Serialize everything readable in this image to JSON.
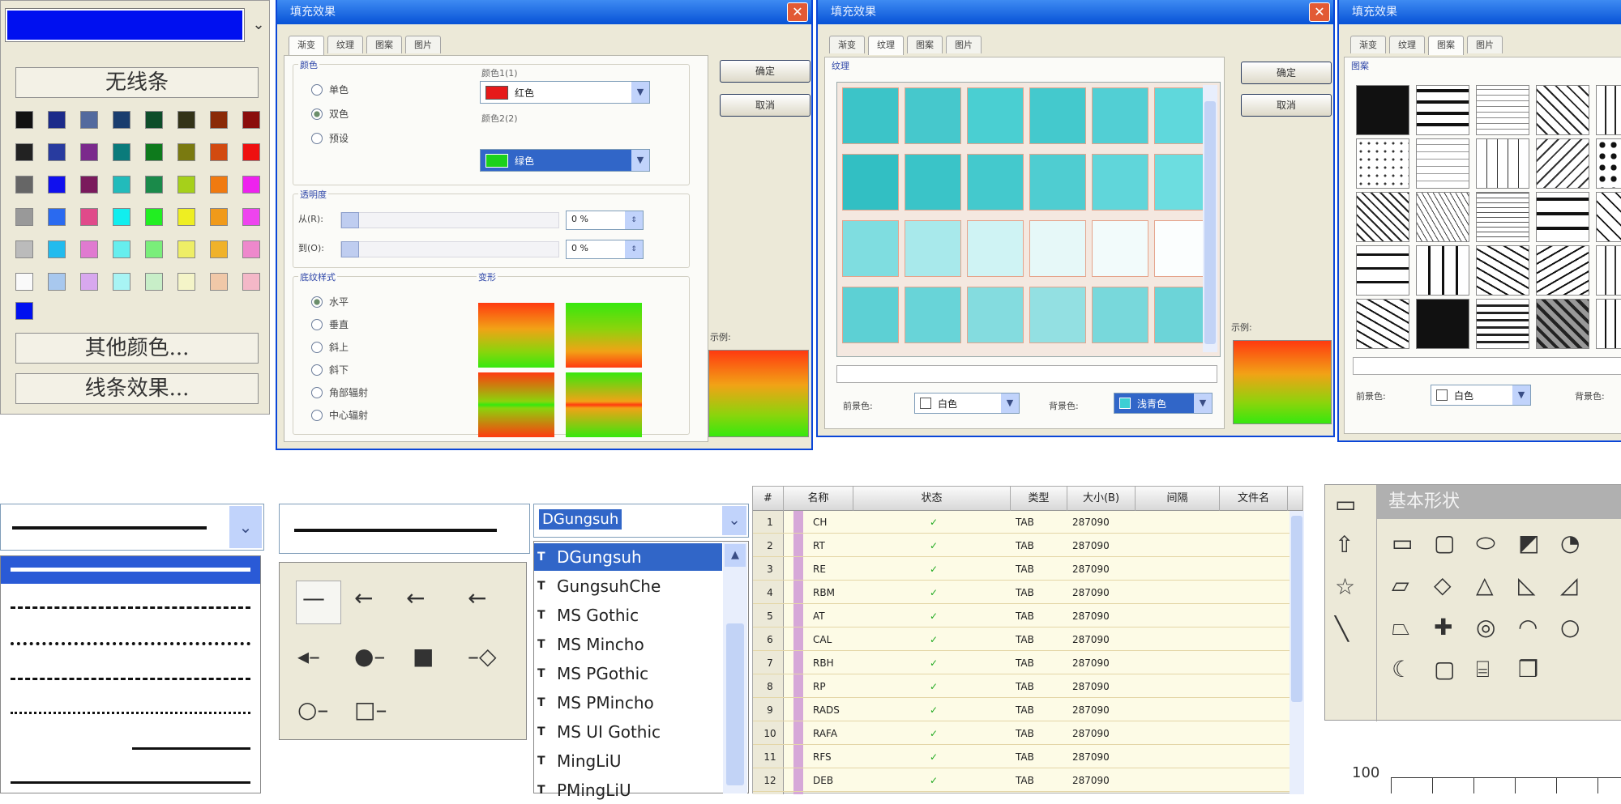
{
  "palette": {
    "no_line_label": "无线条",
    "other_colors_label": "其他颜色...",
    "line_effects_label": "线条效果...",
    "selected_color": "#0010f0",
    "swatches": [
      [
        "#111111",
        "#1c2b8a",
        "#536a9e",
        "#1a3d6e",
        "#0d4d2a",
        "#333318",
        "#8a2a08",
        "#8a0d0d"
      ],
      [
        "#222222",
        "#283b9f",
        "#7b2a8c",
        "#0a7b7b",
        "#0e7a1c",
        "#7a7a10",
        "#d24a10",
        "#ee1010"
      ],
      [
        "#666666",
        "#1010ee",
        "#7a1a5c",
        "#22bbbb",
        "#1a8a4a",
        "#a6d01a",
        "#f07a10",
        "#ee22ee"
      ],
      [
        "#999999",
        "#2a6af0",
        "#e04a8a",
        "#11eeee",
        "#22ee22",
        "#eeee22",
        "#f09a1a",
        "#ee44ee"
      ],
      [
        "#bbbbbb",
        "#22bbee",
        "#e07ad0",
        "#66eeee",
        "#7aee7a",
        "#eeee66",
        "#f0b22a",
        "#ee88cc"
      ],
      [
        "#fafafa",
        "#a8c8ee",
        "#d8a8ee",
        "#a8f4f4",
        "#c8eec8",
        "#f4f4c8",
        "#f0c8a8",
        "#f4b8c8"
      ]
    ],
    "recent": [
      "#0010f0"
    ]
  },
  "dialog1": {
    "title": "填充效果",
    "tabs": [
      "渐变",
      "纹理",
      "图案",
      "图片"
    ],
    "colors_group": "颜色",
    "radio_one": "单色",
    "radio_two": "双色",
    "radio_preset": "预设",
    "color1_label": "颜色1(1)",
    "color1_value": "红色",
    "color2_label": "颜色2(2)",
    "color2_value": "绿色",
    "transparency_group": "透明度",
    "from_label": "从(R):",
    "to_label": "到(O):",
    "from_value": "0 %",
    "to_value": "0 %",
    "shading_group": "底纹样式",
    "variants_group": "变形",
    "styles": [
      "水平",
      "垂直",
      "斜上",
      "斜下",
      "角部辐射",
      "中心辐射"
    ],
    "ok": "确定",
    "cancel": "取消",
    "sample_label": "示例:"
  },
  "dialog2": {
    "title": "填充效果",
    "tabs": [
      "渐变",
      "纹理",
      "图案",
      "图片"
    ],
    "grid_label": "纹理",
    "ok": "确定",
    "cancel": "取消",
    "fg_label": "前景色:",
    "fg_value": "白色",
    "bg_label": "背景色:",
    "bg_value": "浅青色",
    "sample_label": "示例:",
    "tiles": [
      [
        "#3cc4c8",
        "#46c8cc",
        "#4acfd2",
        "#44c9cd",
        "#52cfd4",
        "#5fd8dc"
      ],
      [
        "#32bfc3",
        "#3ac4c8",
        "#44c9cd",
        "#4fcdd1",
        "#60d6da",
        "#6cdde0"
      ],
      [
        "#7fdde0",
        "#a8e9eb",
        "#cff3f4",
        "#e6f8f8",
        "#f2fbfb",
        "#fbfefe"
      ],
      [
        "#5dd0d4",
        "#68d4d8",
        "#84dcdf",
        "#93e0e2",
        "#78d8db",
        "#6cd4d8"
      ]
    ]
  },
  "dialog3": {
    "title": "填充效果",
    "tabs": [
      "渐变",
      "纹理",
      "图案",
      "图片"
    ],
    "pattern_label": "图案",
    "fg_label": "前景色:",
    "fg_value": "白色",
    "bg_label": "背景色:"
  },
  "line_style": {
    "current": "solid",
    "items": [
      "solid-thick",
      "dashed",
      "dotted",
      "dash-dot",
      "dash-dot-dot",
      "long-dash",
      "long-dash-2"
    ]
  },
  "arrow_style": {
    "items": [
      "line",
      "arrow-left",
      "arrow-open-left",
      "arrow-stealth-left",
      "arrow-diamond-left",
      "oval-left",
      "square-left",
      "diamond-right",
      "oval-end",
      "square-end"
    ]
  },
  "font_list": {
    "selected": "DGungsuh",
    "fonts": [
      "DGungsuh",
      "GungsuhChe",
      "MS Gothic",
      "MS Mincho",
      "MS PGothic",
      "MS PMincho",
      "MS UI Gothic",
      "MingLiU",
      "PMingLiU"
    ]
  },
  "file_table": {
    "headers": [
      "#",
      "名称",
      "状态",
      "类型",
      "大小(B)",
      "间隔",
      "文件名"
    ],
    "rows": [
      [
        "1",
        "CH",
        "✓",
        "TAB",
        "287090",
        "",
        ""
      ],
      [
        "2",
        "RT",
        "✓",
        "TAB",
        "287090",
        "",
        ""
      ],
      [
        "3",
        "RE",
        "✓",
        "TAB",
        "287090",
        "",
        ""
      ],
      [
        "4",
        "RBM",
        "✓",
        "TAB",
        "287090",
        "",
        ""
      ],
      [
        "5",
        "AT",
        "✓",
        "TAB",
        "287090",
        "",
        ""
      ],
      [
        "6",
        "CAL",
        "✓",
        "TAB",
        "287090",
        "",
        ""
      ],
      [
        "7",
        "RBH",
        "✓",
        "TAB",
        "287090",
        "",
        ""
      ],
      [
        "8",
        "RP",
        "✓",
        "TAB",
        "287090",
        "",
        ""
      ],
      [
        "9",
        "RADS",
        "✓",
        "TAB",
        "287090",
        "",
        ""
      ],
      [
        "10",
        "RAFA",
        "✓",
        "TAB",
        "287090",
        "",
        ""
      ],
      [
        "11",
        "RFS",
        "✓",
        "TAB",
        "287090",
        "",
        ""
      ],
      [
        "12",
        "DEB",
        "✓",
        "TAB",
        "287090",
        "",
        ""
      ]
    ]
  },
  "autoshapes": {
    "title": "基本形状",
    "bottom_axis_label": "100"
  }
}
